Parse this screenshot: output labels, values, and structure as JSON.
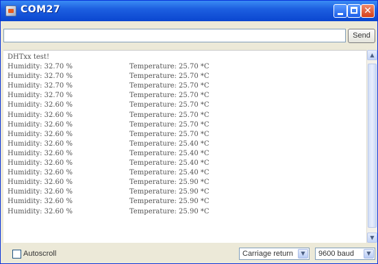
{
  "window": {
    "title": "COM27"
  },
  "input": {
    "value": "",
    "send_label": "Send"
  },
  "monitor": {
    "header": "DHTxx test!",
    "lines": [
      {
        "humidity": "Humidity: 32.70 %",
        "temperature": "Temperature: 25.70 *C"
      },
      {
        "humidity": "Humidity: 32.70 %",
        "temperature": "Temperature: 25.70 *C"
      },
      {
        "humidity": "Humidity: 32.70 %",
        "temperature": "Temperature: 25.70 *C"
      },
      {
        "humidity": "Humidity: 32.70 %",
        "temperature": "Temperature: 25.70 *C"
      },
      {
        "humidity": "Humidity: 32.60 %",
        "temperature": "Temperature: 25.70 *C"
      },
      {
        "humidity": "Humidity: 32.60 %",
        "temperature": "Temperature: 25.70 *C"
      },
      {
        "humidity": "Humidity: 32.60 %",
        "temperature": "Temperature: 25.70 *C"
      },
      {
        "humidity": "Humidity: 32.60 %",
        "temperature": "Temperature: 25.70 *C"
      },
      {
        "humidity": "Humidity: 32.60 %",
        "temperature": "Temperature: 25.40 *C"
      },
      {
        "humidity": "Humidity: 32.60 %",
        "temperature": "Temperature: 25.40 *C"
      },
      {
        "humidity": "Humidity: 32.60 %",
        "temperature": "Temperature: 25.40 *C"
      },
      {
        "humidity": "Humidity: 32.60 %",
        "temperature": "Temperature: 25.40 *C"
      },
      {
        "humidity": "Humidity: 32.60 %",
        "temperature": "Temperature: 25.90 *C"
      },
      {
        "humidity": "Humidity: 32.60 %",
        "temperature": "Temperature: 25.90 *C"
      },
      {
        "humidity": "Humidity: 32.60 %",
        "temperature": "Temperature: 25.90 *C"
      },
      {
        "humidity": "Humidity: 32.60 %",
        "temperature": "Temperature: 25.90 *C"
      }
    ]
  },
  "footer": {
    "autoscroll_label": "Autoscroll",
    "autoscroll_checked": false,
    "line_ending": "Carriage return",
    "baud_rate": "9600 baud"
  },
  "icons": {
    "app": "serial-monitor-icon",
    "minimize": "minimize-icon",
    "maximize": "maximize-icon",
    "close": "close-icon",
    "scroll_up": "chevron-up-icon",
    "scroll_down": "chevron-down-icon",
    "dropdown": "chevron-down-icon"
  },
  "colors": {
    "titlebar": "#1d5fe0",
    "close_button": "#d6401b",
    "text": "#505050"
  }
}
